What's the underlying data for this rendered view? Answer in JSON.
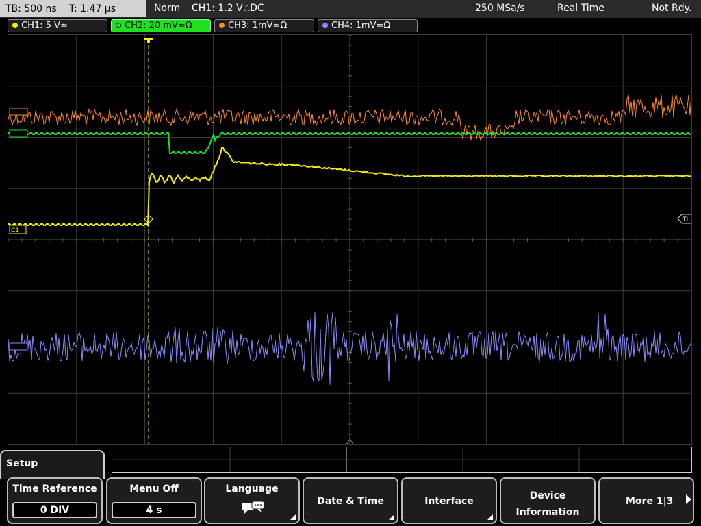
{
  "topbar": {
    "timebase": "TB: 500 ns",
    "trigger_time": "T: 1.47 µs",
    "mode": "Norm",
    "trigger_source": "CH1: 1.2 V",
    "trigger_edge_symbol": "⎍",
    "trigger_coupling": "DC",
    "sample_rate": "250 MSa/s",
    "acquisition": "Real Time",
    "status": "Not Rdy."
  },
  "channels": [
    {
      "label": "CH1: 5 V",
      "symbol": "≃",
      "color": "#f5f000"
    },
    {
      "label": "CH2: 20 mV",
      "symbol": "≃Ω",
      "color": "#1ee01e"
    },
    {
      "label": "CH3: 1mV",
      "symbol": "≃Ω",
      "color": "#ff8a2a"
    },
    {
      "label": "CH4: 1mV",
      "symbol": "≃Ω",
      "color": "#8a8cff"
    }
  ],
  "markers": {
    "ch1_level": "C1",
    "trigger_level": "TL"
  },
  "menu": {
    "tab_label": "Setup",
    "softkeys": [
      {
        "title": "Time Reference",
        "value": "0 DIV"
      },
      {
        "title": "Menu Off",
        "value": "4 s"
      },
      {
        "title": "Language",
        "icon": "speech-bubble-icon"
      },
      {
        "title": "Date & Time"
      },
      {
        "title": "Interface"
      },
      {
        "title_line1": "Device",
        "title_line2": "Information"
      },
      {
        "title": "More 1|3"
      }
    ]
  },
  "colors": {
    "ch1": "#f5f000",
    "ch2": "#1ee01e",
    "ch3": "#ff8a2a",
    "ch4": "#8a8cff",
    "grid": "#3c3c3c"
  }
}
